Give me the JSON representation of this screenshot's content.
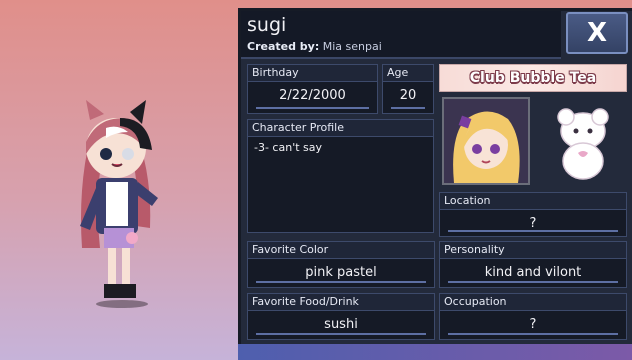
{
  "character": {
    "name": "sugi",
    "created_by_label": "Created by:",
    "created_by": "Mia senpai"
  },
  "close_button": {
    "label": "X",
    "icon": "close-icon"
  },
  "fields": {
    "birthday": {
      "label": "Birthday",
      "value": "2/22/2000"
    },
    "age": {
      "label": "Age",
      "value": "20"
    },
    "profile": {
      "label": "Character Profile",
      "value": "-3- can't say"
    },
    "location": {
      "label": "Location",
      "value": "?"
    },
    "favorite_color": {
      "label": "Favorite Color",
      "value": "pink pastel"
    },
    "personality": {
      "label": "Personality",
      "value": "kind and vilont"
    },
    "favorite_food": {
      "label": "Favorite Food/Drink",
      "value": "sushi"
    },
    "occupation": {
      "label": "Occupation",
      "value": "?"
    }
  },
  "club": {
    "name": "Club Bubble Tea"
  },
  "colors": {
    "panel_bg": "#232a3b",
    "field_bg": "#151a26",
    "accent": "#5d6fa3",
    "background_top": "#e08f8a",
    "background_bottom": "#c6b3d9"
  }
}
